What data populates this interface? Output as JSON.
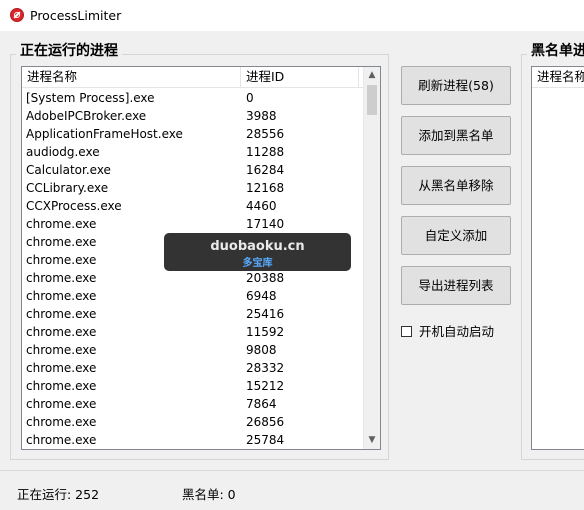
{
  "window": {
    "title": "ProcessLimiter"
  },
  "running_group": {
    "title": "正在运行的进程",
    "columns": [
      "进程名称",
      "进程ID"
    ],
    "rows": [
      {
        "name": "[System Process].exe",
        "pid": "0"
      },
      {
        "name": "AdobeIPCBroker.exe",
        "pid": "3988"
      },
      {
        "name": "ApplicationFrameHost.exe",
        "pid": "28556"
      },
      {
        "name": "audiodg.exe",
        "pid": "11288"
      },
      {
        "name": "Calculator.exe",
        "pid": "16284"
      },
      {
        "name": "CCLibrary.exe",
        "pid": "12168"
      },
      {
        "name": "CCXProcess.exe",
        "pid": "4460"
      },
      {
        "name": "chrome.exe",
        "pid": "17140"
      },
      {
        "name": "chrome.exe",
        "pid": ""
      },
      {
        "name": "chrome.exe",
        "pid": ""
      },
      {
        "name": "chrome.exe",
        "pid": "20388"
      },
      {
        "name": "chrome.exe",
        "pid": "6948"
      },
      {
        "name": "chrome.exe",
        "pid": "25416"
      },
      {
        "name": "chrome.exe",
        "pid": "11592"
      },
      {
        "name": "chrome.exe",
        "pid": "9808"
      },
      {
        "name": "chrome.exe",
        "pid": "28332"
      },
      {
        "name": "chrome.exe",
        "pid": "15212"
      },
      {
        "name": "chrome.exe",
        "pid": "7864"
      },
      {
        "name": "chrome.exe",
        "pid": "26856"
      },
      {
        "name": "chrome.exe",
        "pid": "25784"
      }
    ]
  },
  "buttons": {
    "refresh": "刷新进程(58)",
    "add_blacklist": "添加到黑名单",
    "remove_blacklist": "从黑名单移除",
    "custom_add": "自定义添加",
    "export_list": "导出进程列表"
  },
  "autostart": {
    "label": "开机自动启动",
    "checked": false
  },
  "blacklist_group": {
    "title": "黑名单进",
    "column": "进程名称"
  },
  "watermark": {
    "line1": "duobaoku.cn",
    "line2": "多宝库"
  },
  "status": {
    "running": "正在运行: 252",
    "blacklist": "黑名单: 0"
  }
}
